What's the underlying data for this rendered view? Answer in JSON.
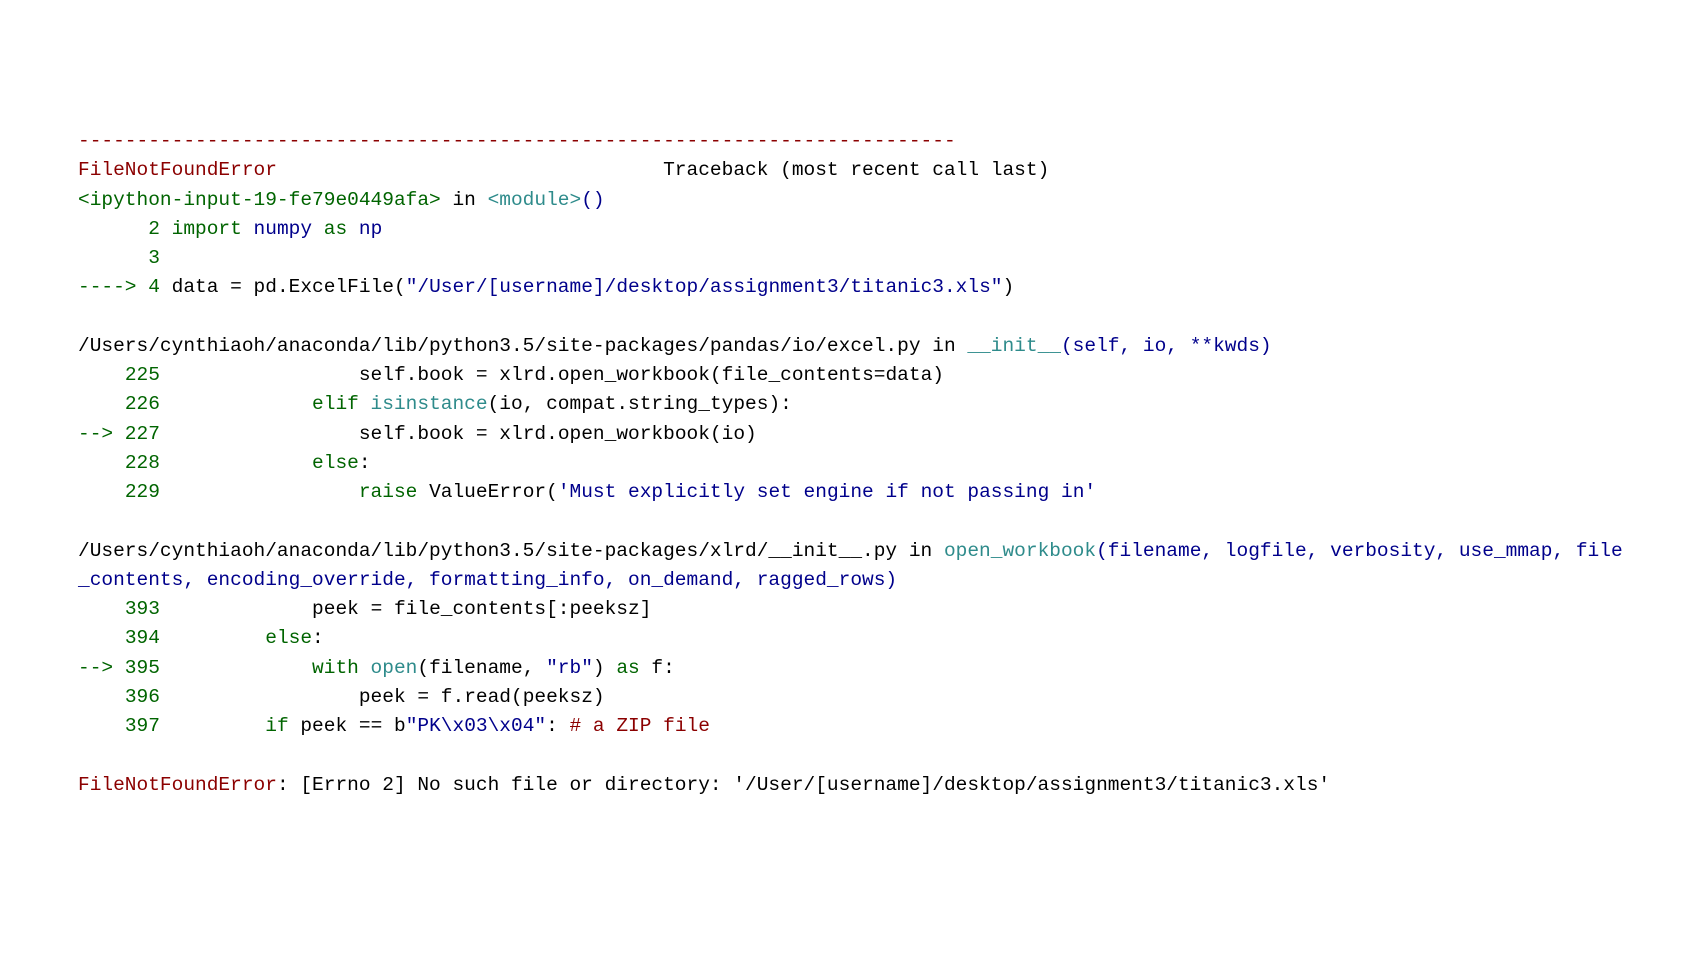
{
  "divider": "---------------------------------------------------------------------------",
  "err_name": "FileNotFoundError",
  "err_header_right": "Traceback (most recent call last)",
  "frame1": {
    "loc_prefix": "<ipython-input-19-fe79e0449afa>",
    "in_word": " in ",
    "func": "<module>",
    "sig": "()",
    "l2_num": "      2",
    "l2_import": " import",
    "l2_numpy": " numpy",
    "l2_as": " as",
    "l2_np": " np",
    "l3_num": "      3",
    "l3_rest": " ",
    "arrow": "----> 4",
    "l4_data": " data ",
    "l4_eq": "=",
    "l4_pd": " pd",
    "l4_dot": ".",
    "l4_ex": "ExcelFile",
    "l4_open": "(",
    "l4_str": "\"/User/[username]/desktop/assignment3/titanic3.xls\"",
    "l4_close": ")"
  },
  "frame2": {
    "path": "/Users/cynthiaoh/anaconda/lib/python3.5/site-packages/pandas/io/excel.py",
    "in_word": " in ",
    "func": "__init__",
    "sig": "(self, io, **kwds)",
    "l225_num": "    225",
    "l225_self": "                 self",
    "l225_dot1": ".",
    "l225_book": "book ",
    "l225_eq": "=",
    "l225_xlrd": " xlrd",
    "l225_dot2": ".",
    "l225_ow": "open_workbook",
    "l225_open": "(",
    "l225_kw": "file_contents",
    "l225_eq2": "=",
    "l225_data": "data",
    "l225_close": ")",
    "l226_num": "    226",
    "l226_elif": "             elif",
    "l226_isinst": " isinstance",
    "l226_open": "(",
    "l226_io": "io",
    "l226_comma": ",",
    "l226_compat": " compat",
    "l226_dot": ".",
    "l226_st": "string_types",
    "l226_close": ")",
    "l226_colon": ":",
    "arrow": "--> 227",
    "l227_self": "                 self",
    "l227_dot1": ".",
    "l227_book": "book ",
    "l227_eq": "=",
    "l227_xlrd": " xlrd",
    "l227_dot2": ".",
    "l227_ow": "open_workbook",
    "l227_open": "(",
    "l227_io": "io",
    "l227_close": ")",
    "l228_num": "    228",
    "l228_else": "             else",
    "l228_colon": ":",
    "l229_num": "    229",
    "l229_raise": "                 raise",
    "l229_ve": " ValueError",
    "l229_open": "(",
    "l229_str": "'Must explicitly set engine if not passing in'"
  },
  "frame3": {
    "path": "/Users/cynthiaoh/anaconda/lib/python3.5/site-packages/xlrd/__init__.py",
    "in_word": " in ",
    "func": "open_workbook",
    "sig": "(filename, logfile, verbosity, use_mmap, file_contents, encoding_override, formatting_info, on_demand, ragged_rows)",
    "l393_num": "    393",
    "l393_peek": "             peek ",
    "l393_eq": "=",
    "l393_fc": " file_contents",
    "l393_open": "[",
    "l393_colon": ":",
    "l393_peeksz": "peeksz",
    "l393_close": "]",
    "l394_num": "    394",
    "l394_else": "         else",
    "l394_colon": ":",
    "arrow": "--> 395",
    "l395_with": "             with",
    "l395_open": " open",
    "l395_op": "(",
    "l395_fn": "filename",
    "l395_comma": ",",
    "l395_rb": " \"rb\"",
    "l395_cp": ")",
    "l395_as": " as",
    "l395_f": " f",
    "l395_colon": ":",
    "l396_num": "    396",
    "l396_peek": "                 peek ",
    "l396_eq": "=",
    "l396_f": " f",
    "l396_dot": ".",
    "l396_read": "read",
    "l396_op": "(",
    "l396_peeksz": "peeksz",
    "l396_cp": ")",
    "l397_num": "    397",
    "l397_if": "         if",
    "l397_peek": " peek ",
    "l397_eq": "==",
    "l397_b": " b",
    "l397_str": "\"PK\\x03\\x04\"",
    "l397_colon": ":",
    "l397_comment": " # a ZIP file"
  },
  "final_err": "FileNotFoundError",
  "final_msg": ": [Errno 2] No such file or directory: '/User/[username]/desktop/assignment3/titanic3.xls'"
}
